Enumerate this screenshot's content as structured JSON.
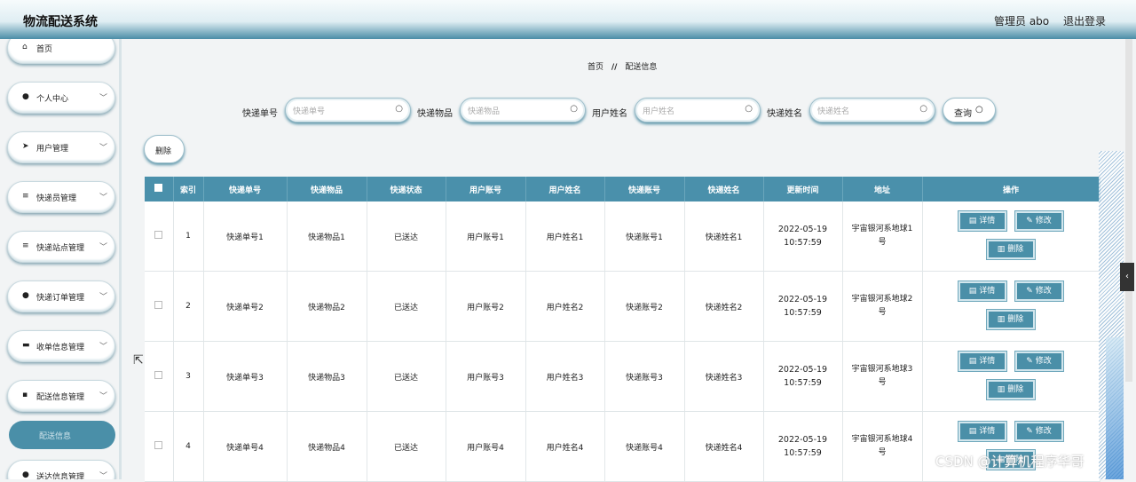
{
  "header": {
    "title": "物流配送系统",
    "user": "管理员 abo",
    "logout": "退出登录"
  },
  "sidebar": {
    "items": [
      {
        "label": "首页",
        "icon": "home-icon",
        "glyph": "⌂",
        "expandable": false
      },
      {
        "label": "个人中心",
        "icon": "person-icon",
        "glyph": "●",
        "expandable": true
      },
      {
        "label": "用户管理",
        "icon": "send-icon",
        "glyph": "➤",
        "expandable": true
      },
      {
        "label": "快递员管理",
        "icon": "list-icon",
        "glyph": "≡",
        "expandable": true
      },
      {
        "label": "快递站点管理",
        "icon": "list-icon",
        "glyph": "≡",
        "expandable": true
      },
      {
        "label": "快递订单管理",
        "icon": "person-icon",
        "glyph": "●",
        "expandable": true
      },
      {
        "label": "收单信息管理",
        "icon": "monitor-icon",
        "glyph": "▬",
        "expandable": true
      },
      {
        "label": "配送信息管理",
        "icon": "grid-icon",
        "glyph": "▪",
        "expandable": true
      },
      {
        "label": "送达信息管理",
        "icon": "person-icon",
        "glyph": "●",
        "expandable": true
      }
    ],
    "active_sub": "配送信息"
  },
  "breadcrumb": {
    "home": "首页",
    "sep": "//",
    "current": "配送信息"
  },
  "search": {
    "fields": [
      {
        "label": "快递单号",
        "placeholder": "快递单号"
      },
      {
        "label": "快递物品",
        "placeholder": "快递物品"
      },
      {
        "label": "用户姓名",
        "placeholder": "用户姓名"
      },
      {
        "label": "快递姓名",
        "placeholder": "快递姓名"
      }
    ],
    "query_label": "查询"
  },
  "toolbar": {
    "delete_label": "删除"
  },
  "table": {
    "headers": [
      "索引",
      "快递单号",
      "快递物品",
      "快递状态",
      "用户账号",
      "用户姓名",
      "快递账号",
      "快递姓名",
      "更新时间",
      "地址",
      "操作"
    ],
    "rows": [
      {
        "index": "1",
        "no": "快递单号1",
        "item": "快递物品1",
        "status": "已送达",
        "account": "用户账号1",
        "name": "用户姓名1",
        "courier_account": "快递账号1",
        "courier_name": "快递姓名1",
        "time": "2022-05-19 10:57:59",
        "address": "宇宙银河系地球1号"
      },
      {
        "index": "2",
        "no": "快递单号2",
        "item": "快递物品2",
        "status": "已送达",
        "account": "用户账号2",
        "name": "用户姓名2",
        "courier_account": "快递账号2",
        "courier_name": "快递姓名2",
        "time": "2022-05-19 10:57:59",
        "address": "宇宙银河系地球2号"
      },
      {
        "index": "3",
        "no": "快递单号3",
        "item": "快递物品3",
        "status": "已送达",
        "account": "用户账号3",
        "name": "用户姓名3",
        "courier_account": "快递账号3",
        "courier_name": "快递姓名3",
        "time": "2022-05-19 10:57:59",
        "address": "宇宙银河系地球3号"
      },
      {
        "index": "4",
        "no": "快递单号4",
        "item": "快递物品4",
        "status": "已送达",
        "account": "用户账号4",
        "name": "用户姓名4",
        "courier_account": "快递账号4",
        "courier_name": "快递姓名4",
        "time": "2022-05-19 10:57:59",
        "address": "宇宙银河系地球4号"
      }
    ],
    "actions": {
      "detail": "详情",
      "edit": "修改",
      "delete": "删除"
    }
  },
  "watermark": "CSDN @计算机程序华哥",
  "colors": {
    "accent": "#4a8fa8",
    "header_bg": "#4a90ab"
  }
}
